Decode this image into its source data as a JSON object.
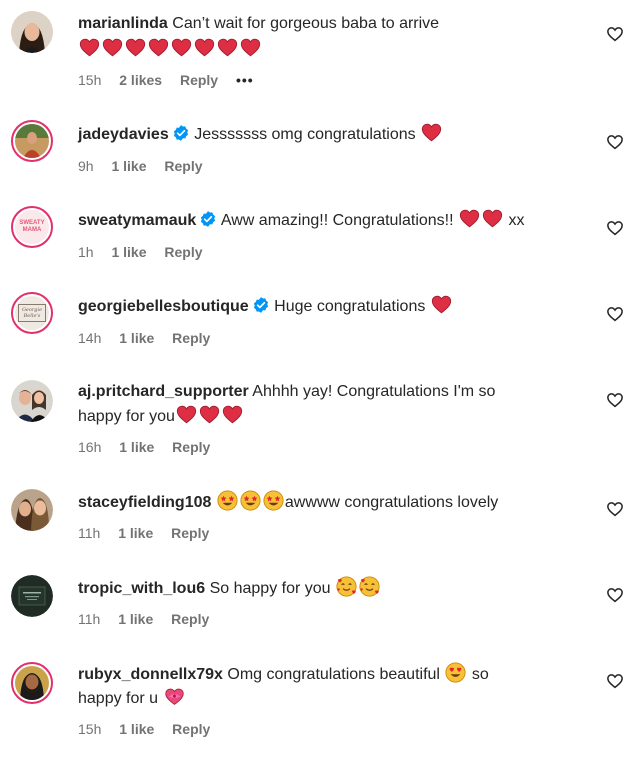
{
  "comments": [
    {
      "avatar": "avatar-photo-woman",
      "username": "marianlinda",
      "verified": false,
      "text": "Can’t wait for gorgeous baba to arrive",
      "emojis_line2": [
        "red-heart",
        "red-heart",
        "red-heart",
        "red-heart",
        "red-heart",
        "red-heart",
        "red-heart",
        "red-heart"
      ],
      "time": "15h",
      "likes": "2 likes",
      "reply": "Reply",
      "more": "•••"
    },
    {
      "avatar": "avatar-photo-person",
      "username": "jadeydavies",
      "verified": true,
      "text": "Jesssssss omg congratulations",
      "time": "9h",
      "likes": "1 like",
      "reply": "Reply"
    },
    {
      "avatar": "avatar-logo-sweatymama",
      "avatar_text": "SWEATY MAMA",
      "username": "sweatymamauk",
      "verified": true,
      "text": "Aww amazing!! Congratulations!!",
      "suffix": "xx",
      "time": "1h",
      "likes": "1 like",
      "reply": "Reply"
    },
    {
      "avatar": "avatar-logo-boutique",
      "avatar_text": "Georgie Belle's",
      "username": "georgiebellesboutique",
      "verified": true,
      "text": "Huge congratulations",
      "time": "14h",
      "likes": "1 like",
      "reply": "Reply"
    },
    {
      "avatar": "avatar-photo-couple",
      "username": "aj.pritchard_supporter",
      "verified": false,
      "text": "Ahhhh yay! Congratulations I'm so",
      "text_line2": "happy for you",
      "time": "16h",
      "likes": "1 like",
      "reply": "Reply"
    },
    {
      "avatar": "avatar-photo-couple",
      "username": "staceyfielding108",
      "verified": false,
      "text": "awwww congratulations lovely",
      "time": "11h",
      "likes": "1 like",
      "reply": "Reply"
    },
    {
      "avatar": "avatar-logo-dark-book",
      "username": "tropic_with_lou6",
      "verified": false,
      "text": "So happy for you",
      "time": "11h",
      "likes": "1 like",
      "reply": "Reply"
    },
    {
      "avatar": "avatar-photo-man",
      "username": "rubyx_donnellx79x",
      "verified": false,
      "text": "Omg congratulations beautiful",
      "text_after_emoji": "so",
      "text_line2": "happy for u",
      "time": "15h",
      "likes": "1 like",
      "reply": "Reply"
    }
  ],
  "colors": {
    "heart": "#e0245e",
    "verified": "#0095f6",
    "meta": "#737373",
    "story_ring": "#e1306c"
  }
}
